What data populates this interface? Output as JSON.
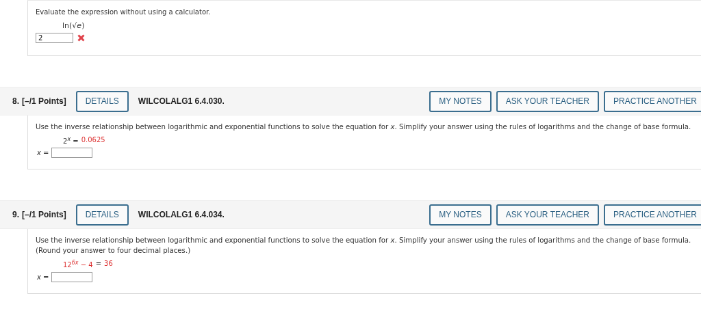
{
  "previous": {
    "prompt": "Evaluate the expression without using a calculator.",
    "expression": "ln(√*e*)",
    "answer": "2",
    "correct": false
  },
  "questions": [
    {
      "number": "8.",
      "points": "[–/1 Points]",
      "details": "DETAILS",
      "code": "WILCOLALG1 6.4.030.",
      "actions": [
        "MY NOTES",
        "ASK YOUR TEACHER",
        "PRACTICE ANOTHER"
      ],
      "prompt": "Use the inverse relationship between logarithmic and exponential functions to solve the equation for *x*. Simplify your answer using the rules of logarithms and the change of base formula.",
      "equation": [
        {
          "text": "2$^{x}$ =",
          "highlighted": false
        },
        {
          "text": "0.0625",
          "highlighted": true
        }
      ],
      "answer_label": "*x* ="
    },
    {
      "number": "9.",
      "points": "[–/1 Points]",
      "details": "DETAILS",
      "code": "WILCOLALG1 6.4.034.",
      "actions": [
        "MY NOTES",
        "ASK YOUR TEACHER",
        "PRACTICE ANOTHER"
      ],
      "prompt": "Use the inverse relationship between logarithmic and exponential functions to solve the equation for *x*. Simplify your answer using the rules of logarithms and the change of base formula. (Round your answer to four decimal places.)",
      "equation": [
        {
          "text": "12$^{6x}$ − 4",
          "highlighted": true
        },
        {
          "text": "=",
          "highlighted": false
        },
        {
          "text": "36",
          "highlighted": true
        }
      ],
      "answer_label": "*x* ="
    }
  ]
}
